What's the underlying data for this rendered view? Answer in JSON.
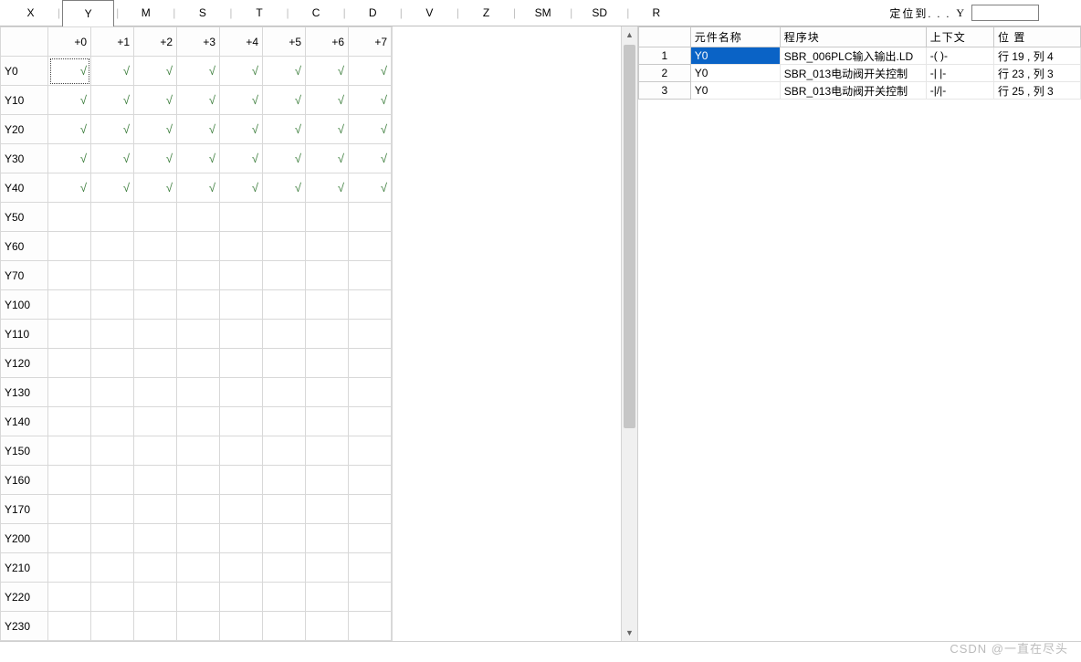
{
  "check_glyph": "√",
  "tabs": {
    "items": [
      "X",
      "Y",
      "M",
      "S",
      "T",
      "C",
      "D",
      "V",
      "Z",
      "SM",
      "SD",
      "R"
    ],
    "active_index": 1
  },
  "locate": {
    "label": "定位到. . .",
    "suffix": "Y",
    "value": ""
  },
  "left_grid": {
    "col_headers": [
      "+0",
      "+1",
      "+2",
      "+3",
      "+4",
      "+5",
      "+6",
      "+7"
    ],
    "row_headers": [
      "Y0",
      "Y10",
      "Y20",
      "Y30",
      "Y40",
      "Y50",
      "Y60",
      "Y70",
      "Y100",
      "Y110",
      "Y120",
      "Y130",
      "Y140",
      "Y150",
      "Y160",
      "Y170",
      "Y200",
      "Y210",
      "Y220",
      "Y230"
    ],
    "checked_rows": {
      "Y0": [
        0,
        1,
        2,
        3,
        4,
        5,
        6,
        7
      ],
      "Y10": [
        0,
        1,
        2,
        3,
        4,
        5,
        6,
        7
      ],
      "Y20": [
        0,
        1,
        2,
        3,
        4,
        5,
        6,
        7
      ],
      "Y30": [
        0,
        1,
        2,
        3,
        4,
        5,
        6,
        7
      ],
      "Y40": [
        0,
        1,
        2,
        3,
        4,
        5,
        6,
        7
      ]
    },
    "selected_cell": {
      "row": "Y0",
      "col": 0
    }
  },
  "right_panel": {
    "headers": {
      "index": "",
      "name": "元件名称",
      "block": "程序块",
      "context": "上下文",
      "position": "位 置"
    },
    "rows": [
      {
        "idx": "1",
        "name": "Y0",
        "block": "SBR_006PLC输入输出.LD",
        "context": "-( )-",
        "position": "行 19 , 列 4",
        "selected": true
      },
      {
        "idx": "2",
        "name": "Y0",
        "block": "SBR_013电动阀开关控制",
        "context": "-| |-",
        "position": "行 23 , 列 3",
        "selected": false
      },
      {
        "idx": "3",
        "name": "Y0",
        "block": "SBR_013电动阀开关控制",
        "context": "-|/|-",
        "position": "行 25 , 列 3",
        "selected": false
      }
    ]
  },
  "watermark": "CSDN @一直在尽头"
}
